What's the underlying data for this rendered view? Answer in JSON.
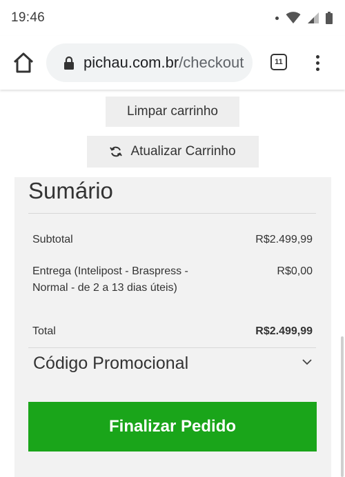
{
  "status": {
    "time": "19:46"
  },
  "browser": {
    "url_domain": "pichau.com.br",
    "url_path": "/checkout",
    "tab_count": "11"
  },
  "cart": {
    "clear_label": "Limpar carrinho",
    "update_label": "Atualizar Carrinho"
  },
  "summary": {
    "title": "Sumário",
    "subtotal_label": "Subtotal",
    "subtotal_value": "R$2.499,99",
    "shipping_label_line1": "Entrega (Intelipost - Braspress -",
    "shipping_label_line2": "Normal - de 2 a 13 dias úteis)",
    "shipping_value": "R$0,00",
    "total_label": "Total",
    "total_value": "R$2.499,99",
    "promo_label": "Código Promocional",
    "checkout_label": "Finalizar Pedido"
  },
  "colors": {
    "checkout_green": "#1aa51a",
    "summary_bg": "#f2f2f2",
    "button_bg": "#eeeeee"
  }
}
